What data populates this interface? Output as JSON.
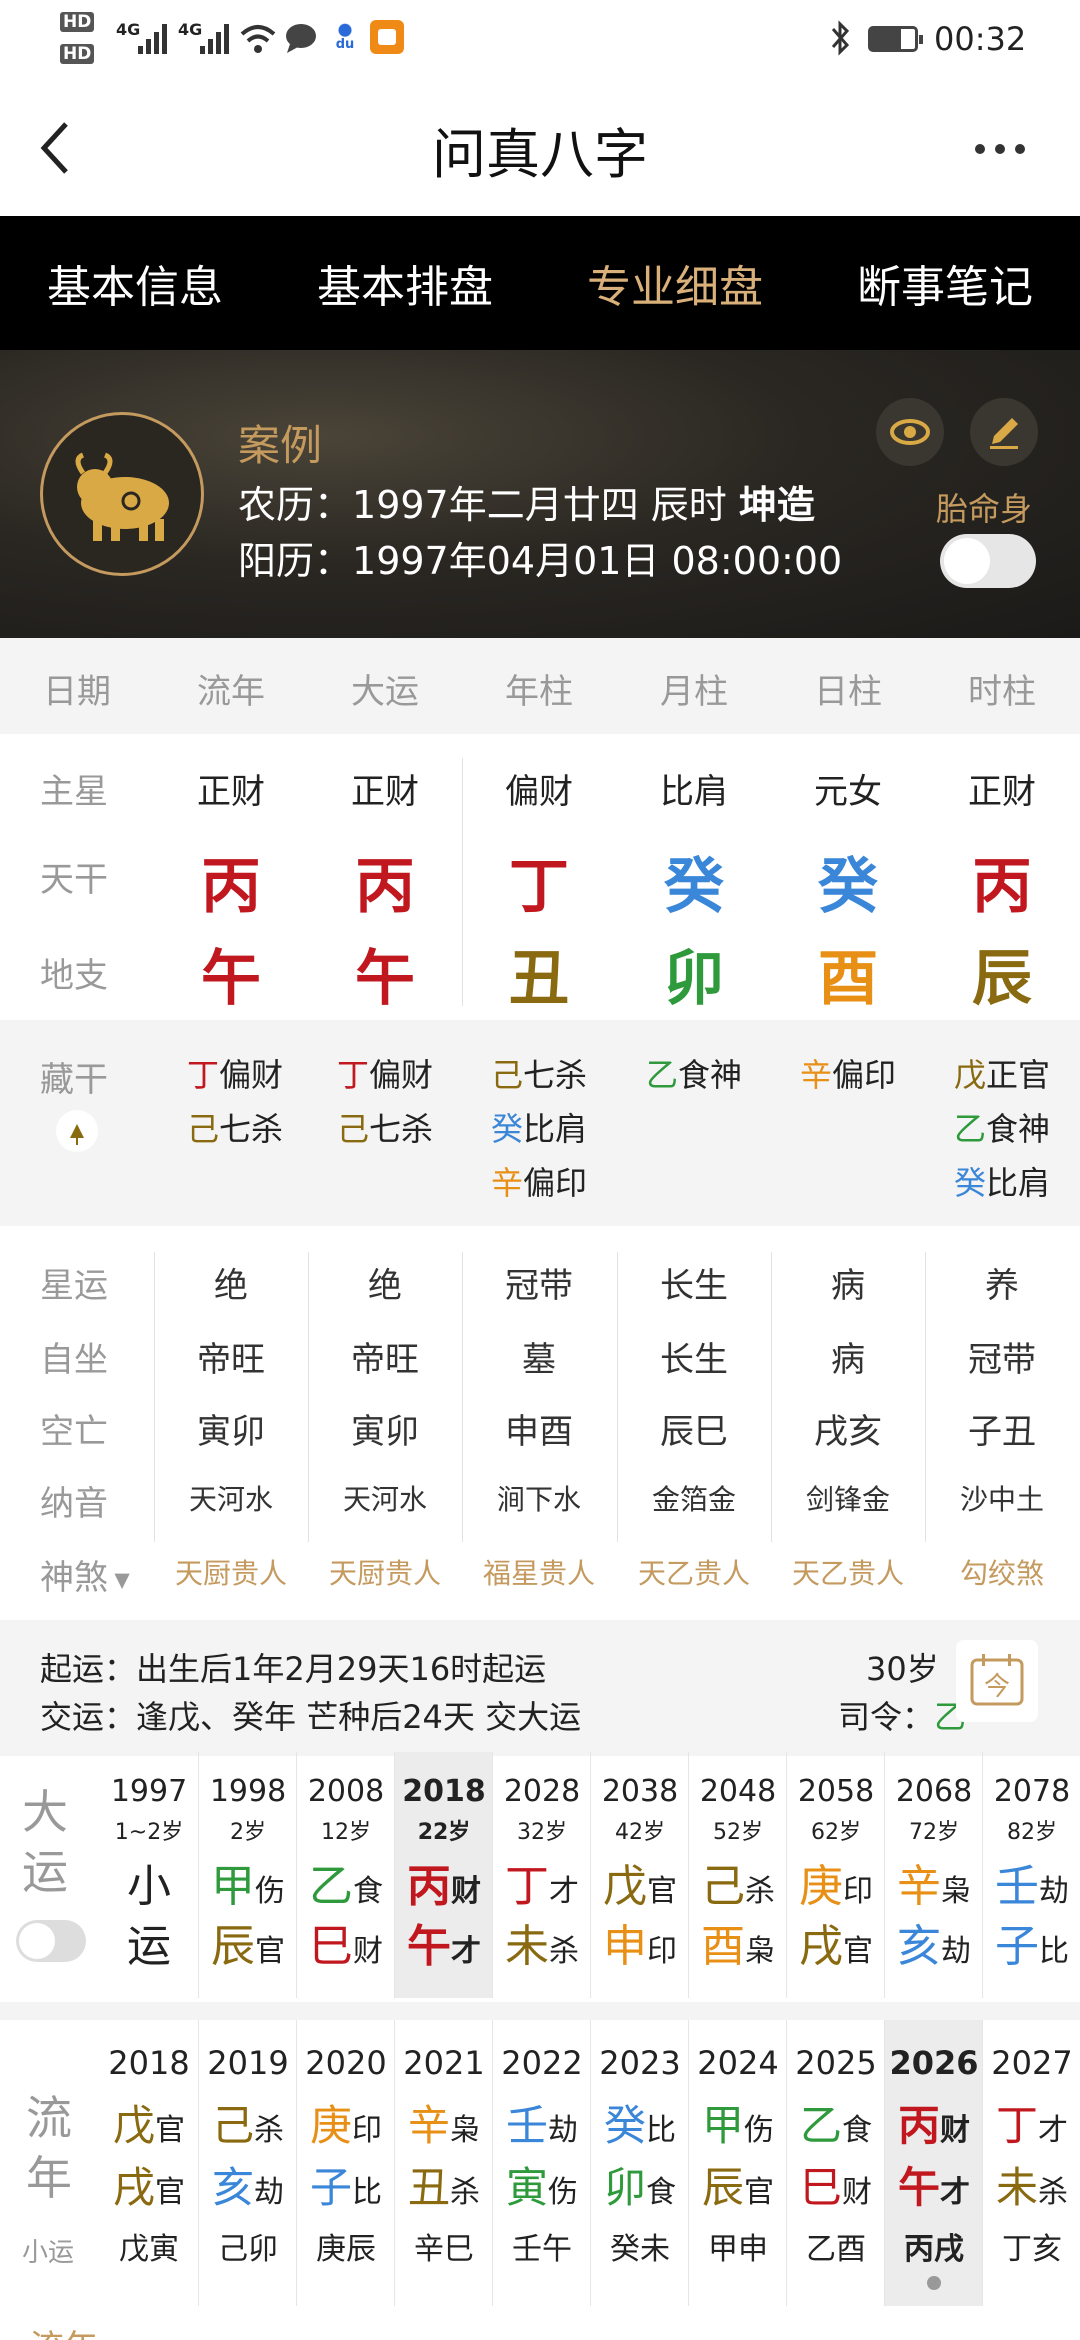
{
  "status_bar": {
    "time": "00:32",
    "hd1": "HD",
    "hd2": "HD",
    "net1": "4G",
    "net2": "4G",
    "baidu": "du"
  },
  "app_bar": {
    "title": "问真八字"
  },
  "tabs": [
    {
      "label": "基本信息"
    },
    {
      "label": "基本排盘"
    },
    {
      "label": "专业细盘",
      "active": true
    },
    {
      "label": "断事笔记"
    }
  ],
  "profile": {
    "name": "案例",
    "lunar_label": "农历：",
    "lunar_value": "1997年二月廿四 辰时",
    "gender": "坤造",
    "solar_label": "阳历：",
    "solar_value": "1997年04月01日 08:00:00",
    "taiming_label": "胎命身"
  },
  "header_row": [
    "日期",
    "流年",
    "大运",
    "年柱",
    "月柱",
    "日柱",
    "时柱"
  ],
  "zhuxing": {
    "label": "主星",
    "values": [
      "正财",
      "正财",
      "偏财",
      "比肩",
      "元女",
      "正财"
    ]
  },
  "tiangan": {
    "label": "天干",
    "values": [
      "丙",
      "丙",
      "丁",
      "癸",
      "癸",
      "丙"
    ]
  },
  "dizhi": {
    "label": "地支",
    "values": [
      "午",
      "午",
      "丑",
      "卯",
      "酉",
      "辰"
    ]
  },
  "canggan": {
    "label": "藏干",
    "cols": [
      [
        {
          "g": "丁",
          "s": "偏财"
        },
        {
          "g": "己",
          "s": "七杀"
        }
      ],
      [
        {
          "g": "丁",
          "s": "偏财"
        },
        {
          "g": "己",
          "s": "七杀"
        }
      ],
      [
        {
          "g": "己",
          "s": "七杀"
        },
        {
          "g": "癸",
          "s": "比肩"
        },
        {
          "g": "辛",
          "s": "偏印"
        }
      ],
      [
        {
          "g": "乙",
          "s": "食神"
        }
      ],
      [
        {
          "g": "辛",
          "s": "偏印"
        }
      ],
      [
        {
          "g": "戊",
          "s": "正官"
        },
        {
          "g": "乙",
          "s": "食神"
        },
        {
          "g": "癸",
          "s": "比肩"
        }
      ]
    ]
  },
  "xingyun": {
    "label": "星运",
    "values": [
      "绝",
      "绝",
      "冠带",
      "长生",
      "病",
      "养"
    ]
  },
  "zizuo": {
    "label": "自坐",
    "values": [
      "帝旺",
      "帝旺",
      "墓",
      "长生",
      "病",
      "冠带"
    ]
  },
  "kongwang": {
    "label": "空亡",
    "values": [
      "寅卯",
      "寅卯",
      "申酉",
      "辰巳",
      "戌亥",
      "子丑"
    ]
  },
  "nayin": {
    "label": "纳音",
    "values": [
      "天河水",
      "天河水",
      "涧下水",
      "金箔金",
      "剑锋金",
      "沙中土"
    ]
  },
  "shensha": {
    "label": "神煞",
    "values": [
      "天厨贵人",
      "天厨贵人",
      "福星贵人",
      "天乙贵人",
      "天乙贵人",
      "勾绞煞"
    ]
  },
  "qiyun": {
    "label": "起运：",
    "value": "出生后1年2月29天16时起运",
    "age": "30岁"
  },
  "jiaoyun": {
    "label": "交运：",
    "value": "逢戊、癸年 芒种后24天 交大运",
    "siling_label": "司令：",
    "siling_value": "乙"
  },
  "dayun": {
    "label1": "大",
    "label2": "运",
    "items": [
      {
        "year": "1997",
        "age": "1~2岁",
        "g": "小",
        "gs": "",
        "z": "运",
        "zs": ""
      },
      {
        "year": "1998",
        "age": "2岁",
        "g": "甲",
        "gs": "伤",
        "z": "辰",
        "zs": "官"
      },
      {
        "year": "2008",
        "age": "12岁",
        "g": "乙",
        "gs": "食",
        "z": "巳",
        "zs": "财"
      },
      {
        "year": "2018",
        "age": "22岁",
        "g": "丙",
        "gs": "财",
        "z": "午",
        "zs": "才",
        "current": true
      },
      {
        "year": "2028",
        "age": "32岁",
        "g": "丁",
        "gs": "才",
        "z": "未",
        "zs": "杀"
      },
      {
        "year": "2038",
        "age": "42岁",
        "g": "戊",
        "gs": "官",
        "z": "申",
        "zs": "印"
      },
      {
        "year": "2048",
        "age": "52岁",
        "g": "己",
        "gs": "杀",
        "z": "酉",
        "zs": "枭"
      },
      {
        "year": "2058",
        "age": "62岁",
        "g": "庚",
        "gs": "印",
        "z": "戌",
        "zs": "官"
      },
      {
        "year": "2068",
        "age": "72岁",
        "g": "辛",
        "gs": "枭",
        "z": "亥",
        "zs": "劫"
      },
      {
        "year": "2078",
        "age": "82岁",
        "g": "壬",
        "gs": "劫",
        "z": "子",
        "zs": "比"
      }
    ]
  },
  "liunian": {
    "label1": "流",
    "label2": "年",
    "label3": "小运",
    "items": [
      {
        "year": "2018",
        "g": "戊",
        "gs": "官",
        "z": "戌",
        "zs": "官",
        "xy": "戊寅"
      },
      {
        "year": "2019",
        "g": "己",
        "gs": "杀",
        "z": "亥",
        "zs": "劫",
        "xy": "己卯"
      },
      {
        "year": "2020",
        "g": "庚",
        "gs": "印",
        "z": "子",
        "zs": "比",
        "xy": "庚辰"
      },
      {
        "year": "2021",
        "g": "辛",
        "gs": "枭",
        "z": "丑",
        "zs": "杀",
        "xy": "辛巳"
      },
      {
        "year": "2022",
        "g": "壬",
        "gs": "劫",
        "z": "寅",
        "zs": "伤",
        "xy": "壬午"
      },
      {
        "year": "2023",
        "g": "癸",
        "gs": "比",
        "z": "卯",
        "zs": "食",
        "xy": "癸未"
      },
      {
        "year": "2024",
        "g": "甲",
        "gs": "伤",
        "z": "辰",
        "zs": "官",
        "xy": "甲申"
      },
      {
        "year": "2025",
        "g": "乙",
        "gs": "食",
        "z": "巳",
        "zs": "财",
        "xy": "乙酉"
      },
      {
        "year": "2026",
        "g": "丙",
        "gs": "财",
        "z": "午",
        "zs": "才",
        "xy": "丙戌",
        "current": true
      },
      {
        "year": "2027",
        "g": "丁",
        "gs": "才",
        "z": "未",
        "zs": "杀",
        "xy": "丁亥"
      }
    ]
  },
  "footer": {
    "partial": "流年"
  },
  "colors": {
    "wood": "#2e9a3c",
    "fire": "#c0181e",
    "earth": "#8a6a10",
    "metal": "#e88f16",
    "water": "#3a86d8",
    "gold": "#c49a5e"
  }
}
